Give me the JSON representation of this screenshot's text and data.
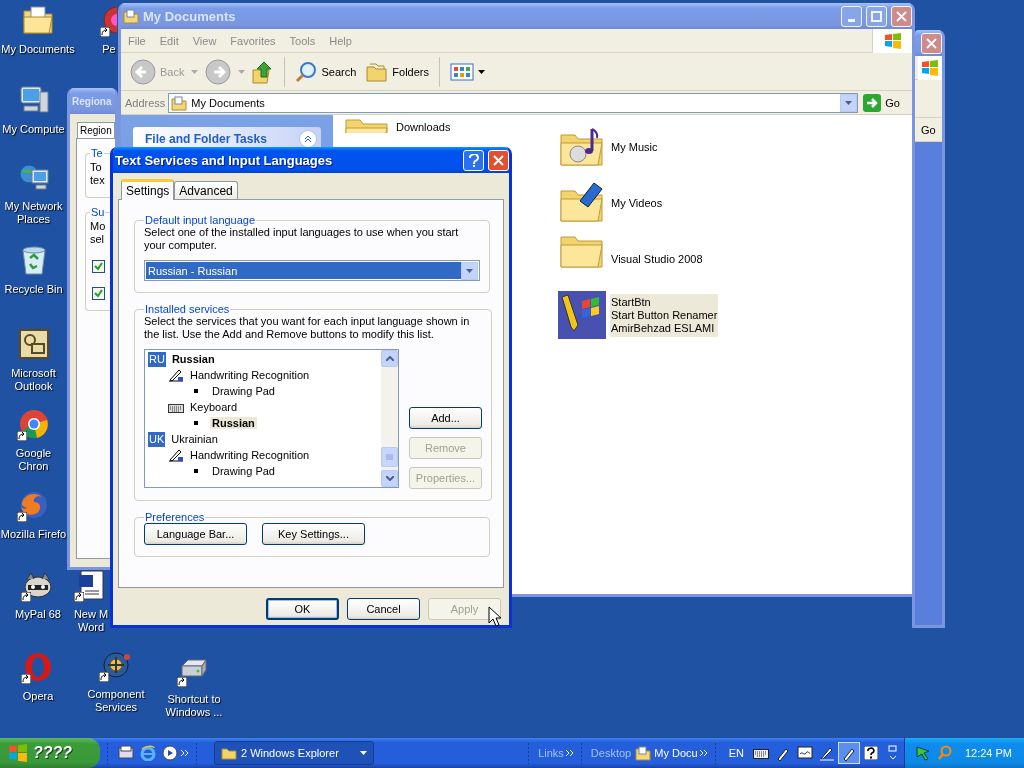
{
  "desktop_icons": [
    {
      "label": "My Documents",
      "kind": "documents",
      "shortcut": false
    },
    {
      "label": "Pe",
      "kind": "generic",
      "shortcut": true
    },
    {
      "label": "My Compute",
      "kind": "computer",
      "shortcut": false
    },
    {
      "label": "My Network Places",
      "kind": "network",
      "shortcut": false
    },
    {
      "label": "Recycle Bin",
      "kind": "recycle",
      "shortcut": false
    },
    {
      "label": "Microsoft Outlook",
      "kind": "outlook",
      "shortcut": false
    },
    {
      "label": "Google Chron",
      "kind": "chrome",
      "shortcut": true
    },
    {
      "label": "Mozilla Firefo",
      "kind": "firefox",
      "shortcut": true
    },
    {
      "label": "MyPal 68",
      "kind": "mypal",
      "shortcut": true
    },
    {
      "label": "New M Word",
      "kind": "word",
      "shortcut": true
    },
    {
      "label": "Opera",
      "kind": "opera",
      "shortcut": true
    },
    {
      "label": "Component Services",
      "kind": "component",
      "shortcut": true
    },
    {
      "label": "Shortcut to Windows ...",
      "kind": "drive",
      "shortcut": true
    }
  ],
  "regional_window": {
    "title": "Regiona",
    "tab": "Region",
    "group_1": {
      "title": "Te",
      "lines": [
        "To",
        "tex"
      ]
    },
    "group_2": {
      "title": "Su",
      "lines": [
        "Mo",
        "sel"
      ]
    },
    "checkboxes": [
      {
        "checked": true
      },
      {
        "checked": true
      }
    ]
  },
  "background_window": {
    "go_button": "Go"
  },
  "explorer": {
    "title": "My Documents",
    "menu": [
      "File",
      "Edit",
      "View",
      "Favorites",
      "Tools",
      "Help"
    ],
    "toolbar": {
      "back": "Back",
      "search": "Search",
      "folders": "Folders"
    },
    "address": {
      "label": "Address",
      "value": "My Documents",
      "go": "Go"
    },
    "task_pane": {
      "title": "File and Folder Tasks"
    },
    "items": [
      {
        "name": "Downloads",
        "kind": "folder",
        "selected": false
      },
      {
        "name": "My Music",
        "kind": "music",
        "selected": false
      },
      {
        "name": "My Videos",
        "kind": "videos",
        "selected": false
      },
      {
        "name": "Visual Studio 2008",
        "kind": "folder",
        "selected": false
      },
      {
        "name": "StartBtn",
        "lines": [
          "Start Button Renamer",
          "AmirBehzad ESLAMI"
        ],
        "kind": "app",
        "selected": true
      }
    ]
  },
  "dialog": {
    "title": "Text Services and Input Languages",
    "tabs": [
      {
        "label": "Settings",
        "selected": true
      },
      {
        "label": "Advanced",
        "selected": false
      }
    ],
    "default_language": {
      "title": "Default input language",
      "description": "Select one of the installed input languages to use when you start your computer.",
      "value": "Russian - Russian"
    },
    "installed_services": {
      "title": "Installed services",
      "description": "Select the services that you want for each input language shown in the list. Use the Add and Remove buttons to modify this list.",
      "languages": [
        {
          "code": "RU",
          "name": "Russian",
          "default": true,
          "children": [
            {
              "name": "Handwriting Recognition",
              "kind": "handwriting",
              "children": [
                {
                  "name": "Drawing Pad",
                  "default": false,
                  "selected": false
                }
              ]
            },
            {
              "name": "Keyboard",
              "kind": "keyboard",
              "children": [
                {
                  "name": "Russian",
                  "default": true,
                  "selected": true
                }
              ]
            }
          ]
        },
        {
          "code": "UK",
          "name": "Ukrainian",
          "default": false,
          "children": [
            {
              "name": "Handwriting Recognition",
              "kind": "handwriting",
              "children": [
                {
                  "name": "Drawing Pad",
                  "default": false,
                  "selected": false
                }
              ]
            }
          ]
        }
      ],
      "buttons": [
        {
          "label": "Add...",
          "disabled": false
        },
        {
          "label": "Remove",
          "disabled": true
        },
        {
          "label": "Properties...",
          "disabled": true
        }
      ]
    },
    "preferences": {
      "title": "Preferences",
      "buttons": [
        "Language Bar...",
        "Key Settings..."
      ]
    },
    "buttons": [
      {
        "label": "OK",
        "default": true,
        "disabled": false
      },
      {
        "label": "Cancel",
        "default": false,
        "disabled": false
      },
      {
        "label": "Apply",
        "default": false,
        "disabled": true
      }
    ]
  },
  "taskbar": {
    "start": "????",
    "task_button": "2 Windows Explorer",
    "links": "Links",
    "desktop": "Desktop",
    "my_docs": "My Docu",
    "language": "EN",
    "clock": "12:24 PM"
  }
}
